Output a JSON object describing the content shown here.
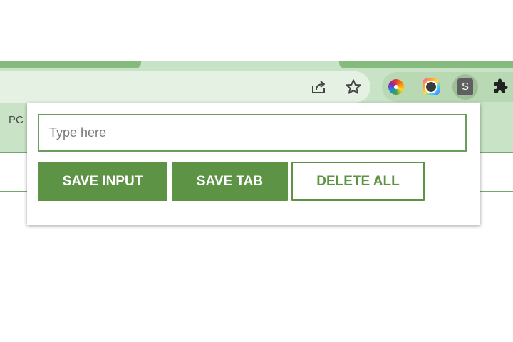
{
  "browser": {
    "bookmarks_bar": {
      "partial_label": "PC"
    },
    "toolbar": {
      "icons": [
        "share-icon",
        "bookmark-star-icon",
        "color-picker-extension-icon",
        "camera-extension-icon",
        "s-extension-icon",
        "puzzle-extensions-icon"
      ],
      "s_extension_letter": "S"
    }
  },
  "popup": {
    "input": {
      "value": "",
      "placeholder": "Type here"
    },
    "buttons": {
      "save_input": "SAVE INPUT",
      "save_tab": "SAVE TAB",
      "delete_all": "DELETE ALL"
    }
  },
  "colors": {
    "accent": "#5d9345",
    "toolbar_bg": "#c9e3c6",
    "tab_accent": "#85bb7d"
  }
}
